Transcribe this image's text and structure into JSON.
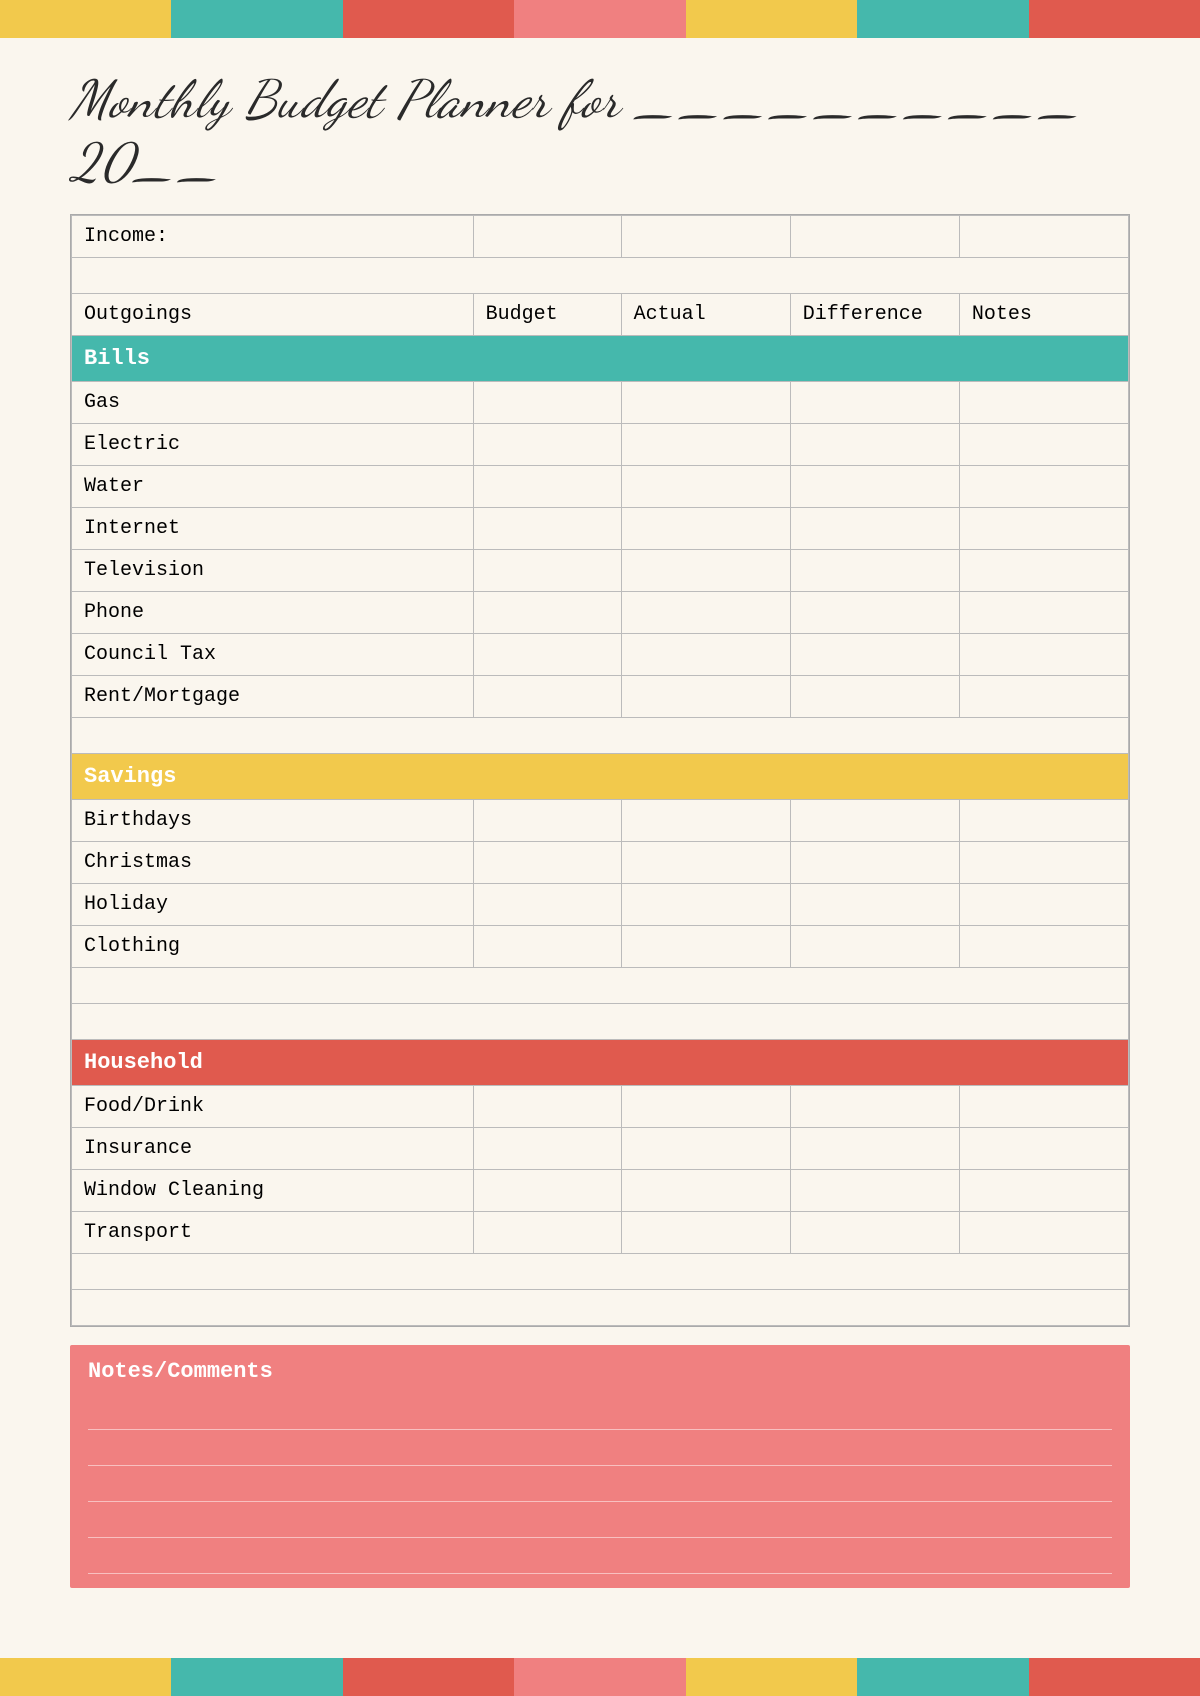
{
  "topBar": {
    "segments": [
      "yellow",
      "teal",
      "red",
      "pink",
      "yellow",
      "teal",
      "red"
    ]
  },
  "bottomBar": {
    "segments": [
      "yellow",
      "teal",
      "red",
      "pink",
      "yellow",
      "teal",
      "red"
    ]
  },
  "title": {
    "text": "Monthly Budget Planner for __________ 20__"
  },
  "table": {
    "incomeLabel": "Income:",
    "headers": {
      "outgoings": "Outgoings",
      "budget": "Budget",
      "actual": "Actual",
      "difference": "Difference",
      "notes": "Notes"
    },
    "sections": {
      "bills": {
        "label": "Bills",
        "items": [
          "Gas",
          "Electric",
          "Water",
          "Internet",
          "Television",
          "Phone",
          "Council Tax",
          "Rent/Mortgage"
        ]
      },
      "savings": {
        "label": "Savings",
        "items": [
          "Birthdays",
          "Christmas",
          "Holiday",
          "Clothing"
        ]
      },
      "household": {
        "label": "Household",
        "items": [
          "Food/Drink",
          "Insurance",
          "Window Cleaning",
          "Transport"
        ]
      }
    }
  },
  "notesSection": {
    "label": "Notes/Comments",
    "lines": 5
  }
}
